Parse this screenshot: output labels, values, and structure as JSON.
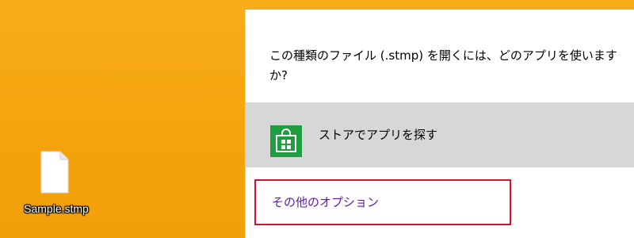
{
  "desktop": {
    "file": {
      "name": "Sample.stmp",
      "icon": "document-icon"
    }
  },
  "flyout": {
    "title": "この種類のファイル (.stmp) を開くには、どのアプリを使いますか?",
    "store_option": {
      "label": "ストアでアプリを探す",
      "icon": "store-icon"
    },
    "more_options": {
      "label": "その他のオプション"
    }
  },
  "colors": {
    "desktop_background": "#f5a40f",
    "flyout_background": "#ffffff",
    "store_row_background": "#d7d7d7",
    "store_icon_background": "#1f9e3f",
    "more_options_text": "#5b1aa6",
    "highlight_border": "#d3122c"
  }
}
